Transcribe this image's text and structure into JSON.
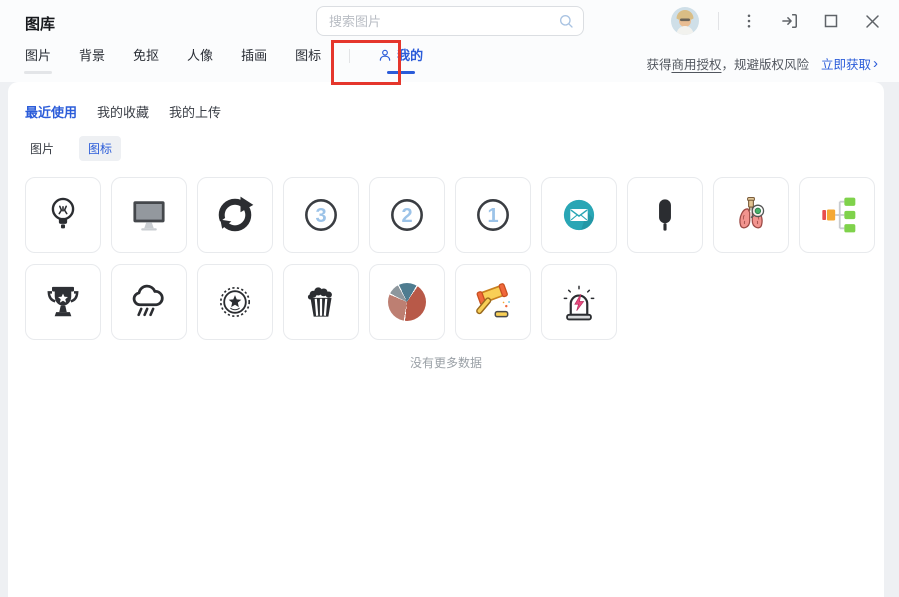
{
  "app": {
    "title": "图库"
  },
  "search": {
    "placeholder": "搜索图片"
  },
  "tabs": [
    {
      "label": "图片"
    },
    {
      "label": "背景"
    },
    {
      "label": "免抠"
    },
    {
      "label": "人像"
    },
    {
      "label": "插画"
    },
    {
      "label": "图标"
    },
    {
      "label": "我的",
      "active": true
    }
  ],
  "promo": {
    "prefix": "获得",
    "underlined": "商用授权",
    "suffix": "，规避版权风险",
    "link": "立即获取",
    "chevron": "›"
  },
  "subtabs": [
    {
      "label": "最近使用",
      "active": true
    },
    {
      "label": "我的收藏"
    },
    {
      "label": "我的上传"
    }
  ],
  "filters": [
    {
      "label": "图片"
    },
    {
      "label": "图标",
      "selected": true
    }
  ],
  "gallery": {
    "items": [
      {
        "icon": "lightbulb"
      },
      {
        "icon": "monitor"
      },
      {
        "icon": "recycle"
      },
      {
        "icon": "circle-number",
        "label": "3"
      },
      {
        "icon": "circle-number",
        "label": "2"
      },
      {
        "icon": "circle-number",
        "label": "1"
      },
      {
        "icon": "email"
      },
      {
        "icon": "popsicle"
      },
      {
        "icon": "lungs"
      },
      {
        "icon": "org-chart"
      },
      {
        "icon": "trophy"
      },
      {
        "icon": "rain-cloud"
      },
      {
        "icon": "star-badge"
      },
      {
        "icon": "popcorn"
      },
      {
        "icon": "pie-chart"
      },
      {
        "icon": "gavel"
      },
      {
        "icon": "siren"
      }
    ],
    "empty_text": "没有更多数据"
  },
  "colors": {
    "accent_blue": "#2b5cd9",
    "annotation_red": "#e5362c",
    "email_teal": "#29a6b5",
    "pie_slices": [
      "#4e7c90",
      "#b85948",
      "#bd7f72",
      "#8d979d"
    ]
  }
}
